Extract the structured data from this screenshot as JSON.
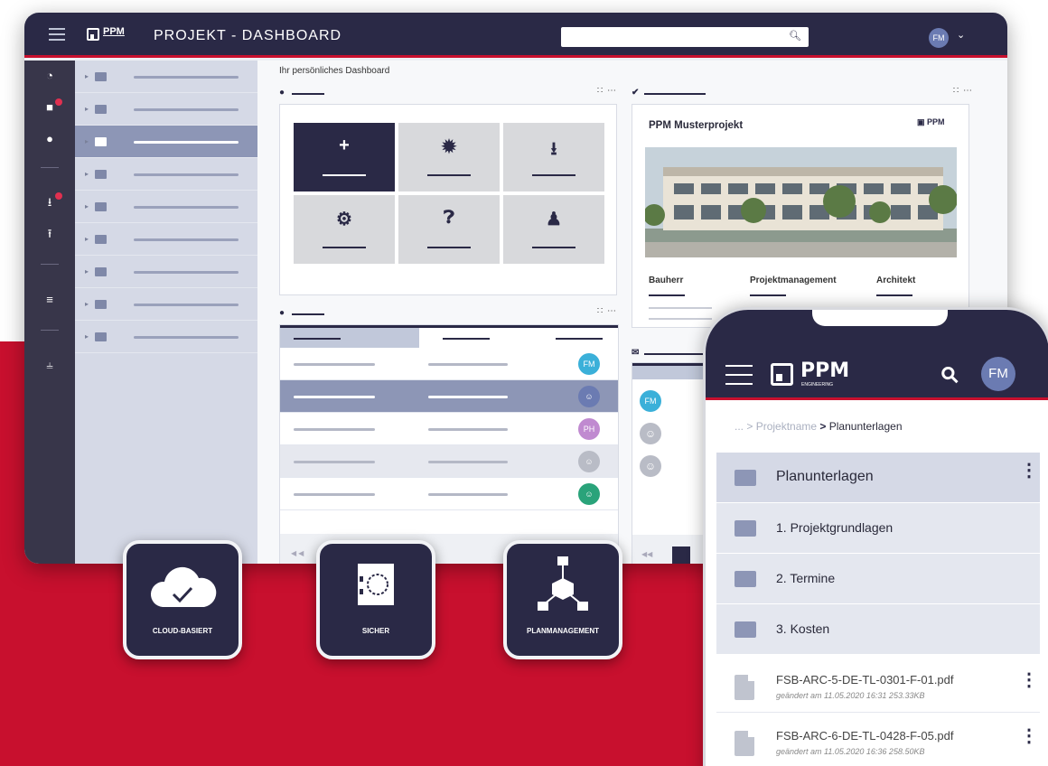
{
  "colors": {
    "primary": "#2a2946",
    "accent": "#c8102e",
    "selection": "#8d96b6"
  },
  "desktop": {
    "logo_text": "PPM",
    "title": "PROJEKT - DASHBOARD",
    "search": {
      "value": "",
      "icon": "search-icon"
    },
    "user_initials": "FM",
    "rail_icons": [
      "dashboard-icon",
      "folder-open-icon",
      "info-icon",
      "download-tray-icon",
      "upload-tray-icon",
      "layers-icon",
      "filter-sliders-icon"
    ],
    "breadcrumb": "Ihr persönliches Dashboard",
    "project": {
      "name": "PPM Musterprojekt",
      "logo_text": "PPM",
      "roles": [
        "Bauherr",
        "Projektmanagement",
        "Architekt"
      ]
    },
    "quick_tiles": [
      "plus-icon",
      "gear-icon",
      "inbox-tray-icon",
      "gears-icon",
      "help-icon",
      "user-tray-icon"
    ],
    "table_avatars": [
      {
        "label": "FM",
        "color": "#3bb0d9"
      },
      {
        "label": "",
        "color": "#6b7bb2"
      },
      {
        "label": "PH",
        "color": "#c08ad0"
      },
      {
        "label": "",
        "color": "#b9bcc6"
      },
      {
        "label": "",
        "color": "#2aa37a"
      }
    ],
    "mail_avatars": [
      {
        "label": "FM",
        "color": "#3bb0d9"
      },
      {
        "label": "",
        "color": "#b9bcc6"
      },
      {
        "label": "",
        "color": "#b9bcc6"
      }
    ]
  },
  "features": [
    {
      "label": "CLOUD-BASIERT",
      "icon": "cloud-check-icon"
    },
    {
      "label": "SICHER",
      "icon": "safe-icon"
    },
    {
      "label": "PLANMANAGEMENT",
      "icon": "network-cube-icon"
    }
  ],
  "phone": {
    "logo_text": "PPM",
    "logo_sub": "ENGINEERING",
    "user_initials": "FM",
    "breadcrumb": {
      "ellipsis": "...",
      "parent": "Projektname",
      "current": "Planunterlagen"
    },
    "folders": [
      "Planunterlagen",
      "1. Projektgrundlagen",
      "2. Termine",
      "3. Kosten"
    ],
    "files": [
      {
        "name": "FSB-ARC-5-DE-TL-0301-F-01.pdf",
        "meta": "geändert am 11.05.2020  16:31   253.33KB"
      },
      {
        "name": "FSB-ARC-6-DE-TL-0428-F-05.pdf",
        "meta": "geändert am 11.05.2020  16:36   258.50KB"
      }
    ]
  }
}
